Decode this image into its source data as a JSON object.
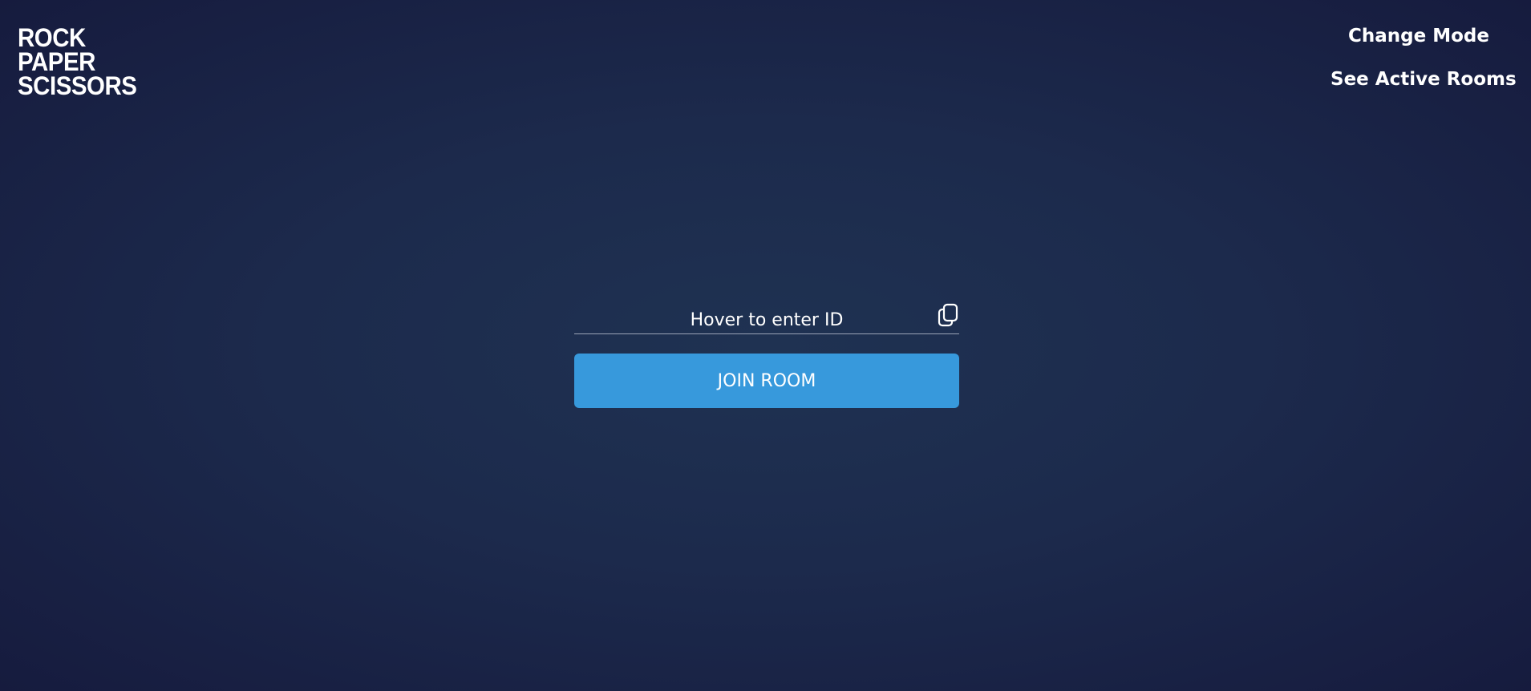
{
  "logo": {
    "lines": [
      "ROCK",
      "PAPER",
      "SCISSORS"
    ]
  },
  "nav": {
    "change_mode": "Change Mode",
    "active_rooms": "See Active Rooms"
  },
  "room_form": {
    "id_placeholder": "Hover to enter ID",
    "copy_icon": "copy-icon",
    "join_label": "JOIN ROOM"
  },
  "colors": {
    "background": "#1c2a4c",
    "accent": "#3799dc",
    "text": "#ffffff"
  }
}
